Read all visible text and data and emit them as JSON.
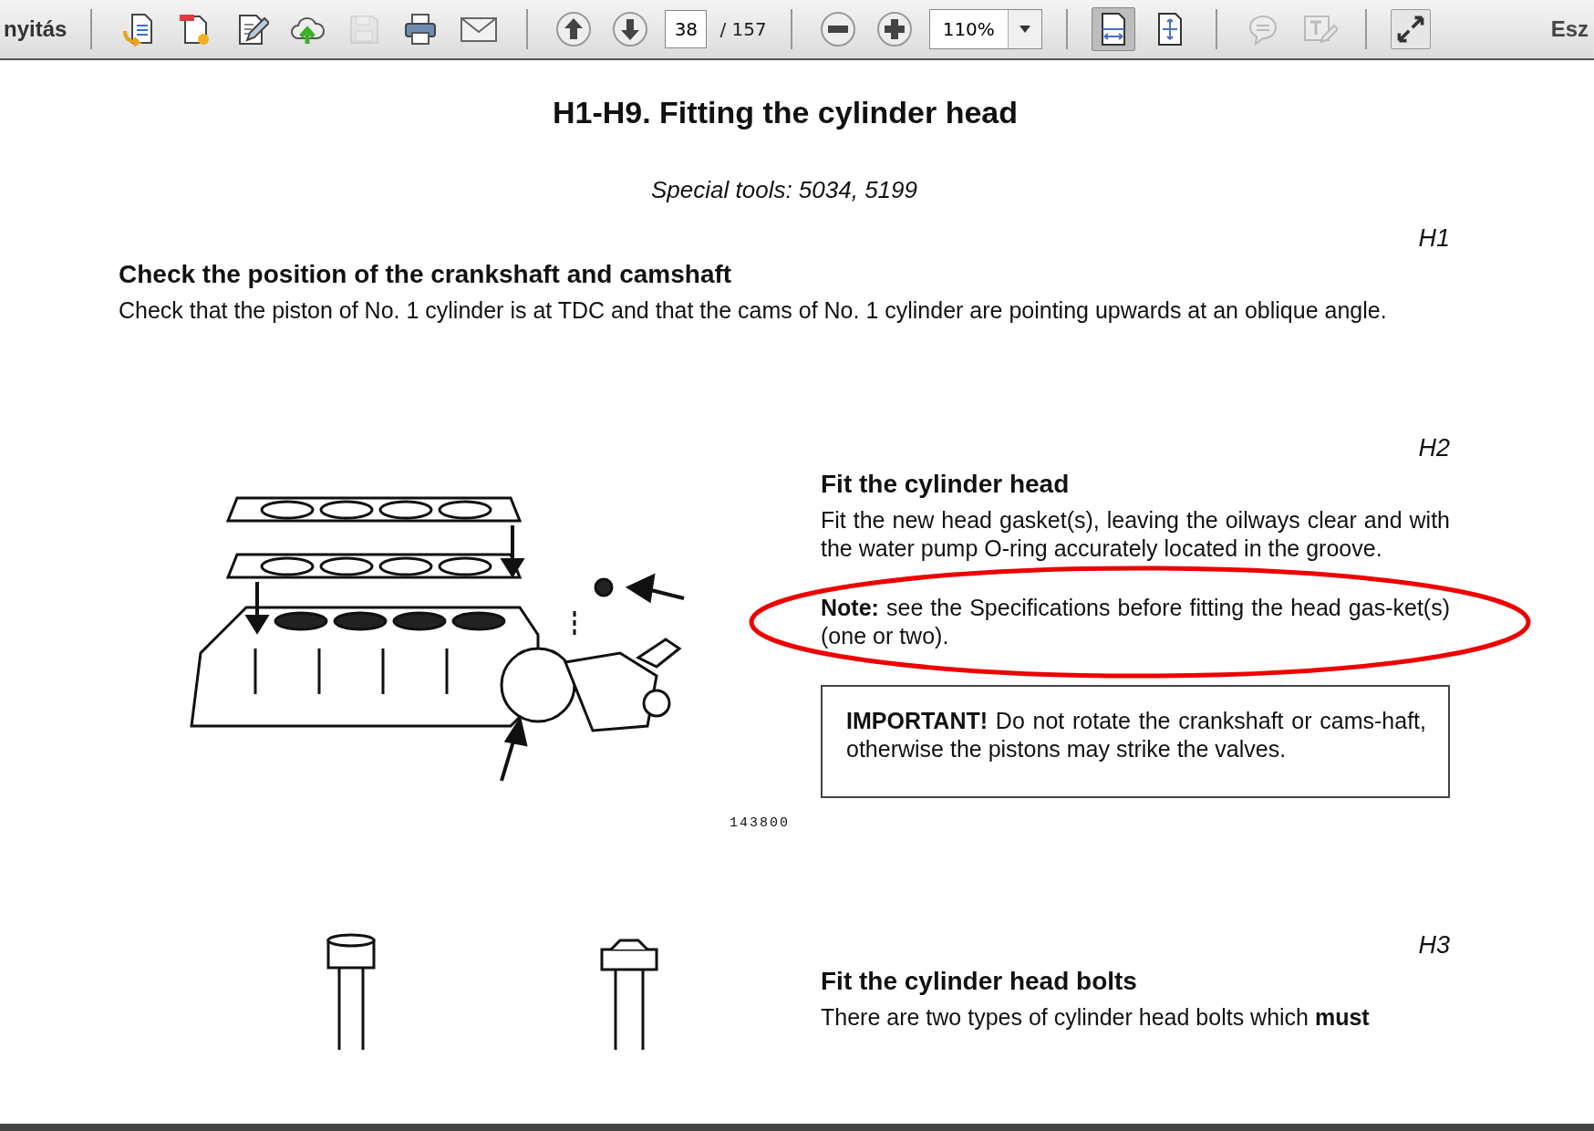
{
  "toolbar": {
    "open_label": "nyitás",
    "file_tools": [
      {
        "disabled": false,
        "selected": false
      },
      {
        "disabled": false,
        "selected": false
      },
      {
        "disabled": false,
        "selected": false
      },
      {
        "disabled": false,
        "selected": false
      },
      {
        "disabled": true,
        "selected": false
      },
      {
        "disabled": false,
        "selected": false
      },
      {
        "disabled": false,
        "selected": false
      }
    ],
    "page_nav": {
      "tools": [
        {
          "disabled": false,
          "selected": false
        },
        {
          "disabled": false,
          "selected": false
        }
      ],
      "page": "38",
      "total": "/ 157"
    },
    "zoom": {
      "tools": [
        {
          "disabled": false,
          "selected": false
        },
        {
          "disabled": false,
          "selected": false
        }
      ],
      "value": "110%"
    },
    "view_tools": [
      {
        "disabled": false,
        "selected": true
      },
      {
        "disabled": false,
        "selected": false
      }
    ],
    "comment_tools": [
      {
        "disabled": true,
        "selected": false
      },
      {
        "disabled": true,
        "selected": false
      }
    ],
    "fullscreen_tool": {
      "disabled": false,
      "selected": false
    },
    "right_label": "Esz"
  },
  "document": {
    "title": "H1-H9. Fitting the cylinder head",
    "special_tools": "Special tools: 5034, 5199",
    "sections": [
      {
        "kind": "full",
        "marker": "H1",
        "heading": "Check the position of the crankshaft and camshaft",
        "text": "Check that the piston of No. 1 cylinder is at TDC and that the cams of No. 1 cylinder are pointing upwards at an oblique angle."
      },
      {
        "kind": "figure",
        "marker": "H2",
        "heading": "Fit the cylinder head",
        "text": "Fit the new head gasket(s), leaving the oilways clear and with the water pump O-ring accurately located in the groove.",
        "note": "**Note:** see the Specifications before fitting the head gas-ket(s) (one or two).",
        "important": "**IMPORTANT!** Do not rotate the crankshaft or cams-haft, otherwise the pistons may strike the valves.",
        "figure_label": "143800"
      },
      {
        "kind": "bolts",
        "marker": "H3",
        "heading": "Fit the cylinder head bolts",
        "text": "There are two types of cylinder head bolts which **must**"
      }
    ]
  }
}
